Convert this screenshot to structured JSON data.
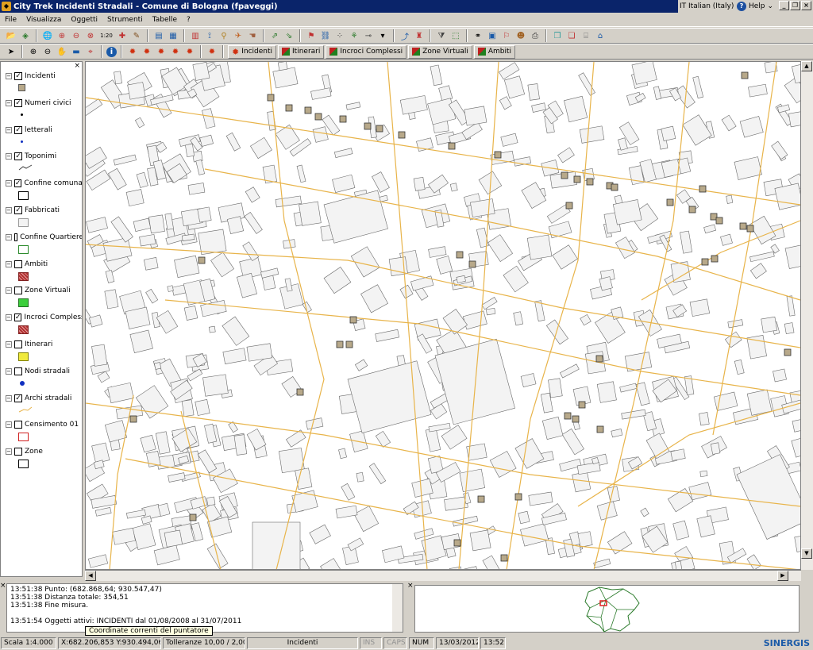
{
  "title": "City Trek Incidenti Stradali - Comune di Bologna (fpaveggi)",
  "language": "IT  Italian (Italy)",
  "help_label": "Help",
  "menu": [
    "File",
    "Visualizza",
    "Oggetti",
    "Strumenti",
    "Tabelle",
    "?"
  ],
  "toolbar_row1_icons": [
    "open-icon",
    "layers-icon",
    "globe-icon",
    "zoom-in-icon",
    "zoom-out-icon",
    "zoom-extent-icon",
    "scale-1-20-icon",
    "zoom-select-icon",
    "pencil-icon",
    "table-icon",
    "grid-icon",
    "measure-icon",
    "chart-icon",
    "link-icon",
    "bird-icon",
    "hand-icon",
    "route-icon",
    "route2-icon",
    "flag-icon",
    "network-icon",
    "dots-icon",
    "tree-icon",
    "connector-icon",
    "export-icon",
    "select-tool-icon",
    "filter-icon",
    "binoculars-icon",
    "car-icon",
    "flags-icon",
    "pedestrian-icon",
    "vehicle-icon",
    "printer-icon",
    "cube-icon",
    "copy-icon",
    "map-icon"
  ],
  "scale_label": "1:20",
  "layer_tabs": [
    {
      "label": "Incidenti",
      "color": "#d03010"
    },
    {
      "label": "Itinerari",
      "color": "#c02020"
    },
    {
      "label": "Incroci Complessi",
      "color": "#c02020"
    },
    {
      "label": "Zone Virtuali",
      "color": "#c02020"
    },
    {
      "label": "Ambiti",
      "color": "#c02020"
    }
  ],
  "legend": [
    {
      "label": "Incidenti",
      "checked": true,
      "symbol": "square-tan"
    },
    {
      "label": "Numeri civici",
      "checked": true,
      "symbol": "dot-black"
    },
    {
      "label": "letterali",
      "checked": true,
      "symbol": "dot-blue"
    },
    {
      "label": "Toponimi",
      "checked": true,
      "symbol": "line-squiggle"
    },
    {
      "label": "Confine comunale",
      "checked": true,
      "symbol": "box-black"
    },
    {
      "label": "Fabbricati",
      "checked": true,
      "symbol": "box-gray"
    },
    {
      "label": "Confine Quartiere",
      "checked": false,
      "symbol": "box-green"
    },
    {
      "label": "Ambiti",
      "checked": false,
      "symbol": "hatch-red"
    },
    {
      "label": "Zone Virtuali",
      "checked": false,
      "symbol": "fill-green"
    },
    {
      "label": "Incroci Complessi",
      "checked": true,
      "symbol": "hatch-red"
    },
    {
      "label": "Itinerari",
      "checked": false,
      "symbol": "fill-yellow"
    },
    {
      "label": "Nodi stradali",
      "checked": false,
      "symbol": "dot-blue-big"
    },
    {
      "label": "Archi stradali",
      "checked": true,
      "symbol": "line-orange"
    },
    {
      "label": "Censimento 01",
      "checked": false,
      "symbol": "box-red"
    },
    {
      "label": "Zone",
      "checked": false,
      "symbol": "box-black"
    }
  ],
  "log": [
    "13:51:38 Punto: (682.868,64; 930.547,47)",
    "13:51:38 Distanza totale: 354,51",
    "13:51:38 Fine misura.",
    "",
    "13:51:54 Oggetti attivi: INCIDENTI dal 01/08/2008 al 31/07/2011"
  ],
  "tooltip": "Coordinate correnti del puntatore",
  "status": {
    "scale": "Scala 1:4.000",
    "coords": "X:682.206,853  Y:930.494,063",
    "tolerance": "Tolleranze 10,00 / 2,00",
    "active_layer": "Incidenti",
    "ins": "INS",
    "caps": "CAPS",
    "num": "NUM",
    "date": "13/03/2012",
    "time": "13:52"
  },
  "brand": "SINERGIS",
  "colors": {
    "title_bar": "#0a246a",
    "road": "#e8b44a",
    "building": "#f3f3f3",
    "incident": "#b8a98a",
    "brand": "#1a5aa8"
  }
}
